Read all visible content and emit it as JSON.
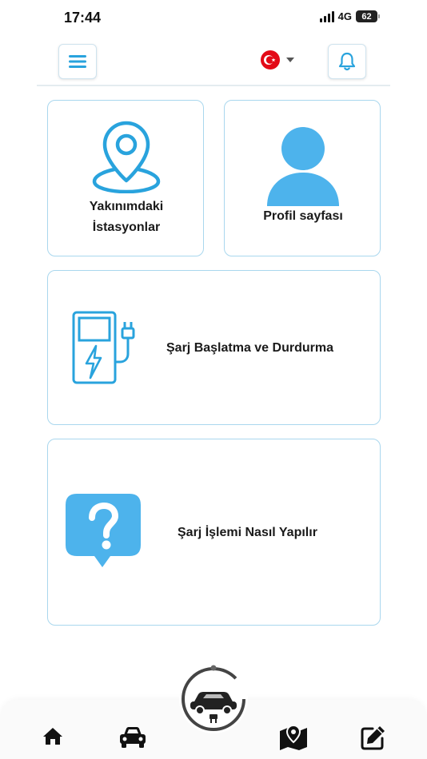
{
  "status_bar": {
    "time": "17:44",
    "network": "4G",
    "battery": "62"
  },
  "header": {
    "menu_icon": "hamburger-menu-icon",
    "language_flag": "turkey-flag-icon",
    "notification_icon": "bell-icon"
  },
  "cards": {
    "nearby": {
      "title_line1": "Yakınımdaki",
      "title_line2": "İstasyonlar",
      "icon": "location-pin-icon"
    },
    "profile": {
      "title": "Profil sayfası",
      "icon": "user-icon"
    },
    "charge": {
      "title": "Şarj Başlatma ve Durdurma",
      "icon": "charging-station-icon"
    },
    "help": {
      "title": "Şarj İşlemi Nasıl Yapılır",
      "icon": "question-bubble-icon"
    }
  },
  "bottom_nav": {
    "items": [
      {
        "icon": "home-icon"
      },
      {
        "icon": "car-icon"
      },
      {
        "icon": "ev-charge-logo-icon"
      },
      {
        "icon": "map-pin-icon"
      },
      {
        "icon": "edit-icon"
      }
    ]
  },
  "colors": {
    "accent": "#29a3dd",
    "accent_light": "#4db3ec",
    "card_border": "#a9d7ee",
    "flag_red": "#e30a17"
  }
}
